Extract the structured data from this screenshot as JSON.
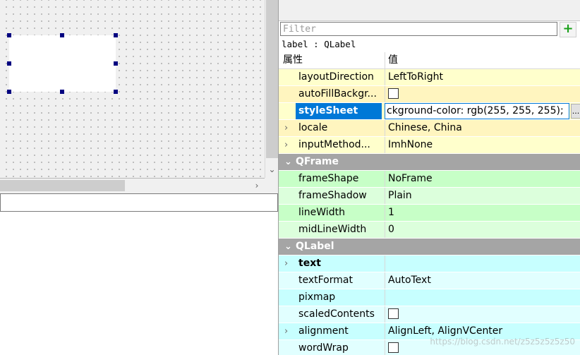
{
  "filter": {
    "placeholder": "Filter",
    "add_icon": "plus-icon"
  },
  "object_label": "label : QLabel",
  "header": {
    "property": "属性",
    "value": "值"
  },
  "rows": {
    "layoutDirection": {
      "name": "layoutDirection",
      "value": "LeftToRight"
    },
    "autoFillBackground": {
      "name": "autoFillBackgr...",
      "checked": false
    },
    "styleSheet": {
      "name": "styleSheet",
      "value": "ckground-color: rgb(255, 255, 255);",
      "more": "..."
    },
    "locale": {
      "name": "locale",
      "value": "Chinese, China"
    },
    "inputMethodHints": {
      "name": "inputMethod...",
      "value": "ImhNone"
    },
    "section_qframe": {
      "name": "QFrame"
    },
    "frameShape": {
      "name": "frameShape",
      "value": "NoFrame"
    },
    "frameShadow": {
      "name": "frameShadow",
      "value": "Plain"
    },
    "lineWidth": {
      "name": "lineWidth",
      "value": "1"
    },
    "midLineWidth": {
      "name": "midLineWidth",
      "value": "0"
    },
    "section_qlabel": {
      "name": "QLabel"
    },
    "text": {
      "name": "text",
      "value": ""
    },
    "textFormat": {
      "name": "textFormat",
      "value": "AutoText"
    },
    "pixmap": {
      "name": "pixmap",
      "value": ""
    },
    "scaledContents": {
      "name": "scaledContents",
      "checked": false
    },
    "alignment": {
      "name": "alignment",
      "value": "AlignLeft, AlignVCenter"
    },
    "wordWrap": {
      "name": "wordWrap",
      "checked": false
    }
  },
  "watermark": "https://blog.csdn.net/z5z5z5z5z50",
  "colors": {
    "selection": "#0078d7",
    "handle": "#000080",
    "section": "#a5a5a5",
    "qwidget_row": "#ffffcc",
    "qframe_row": "#c7ffc7",
    "qlabel_row": "#c7ffff"
  }
}
